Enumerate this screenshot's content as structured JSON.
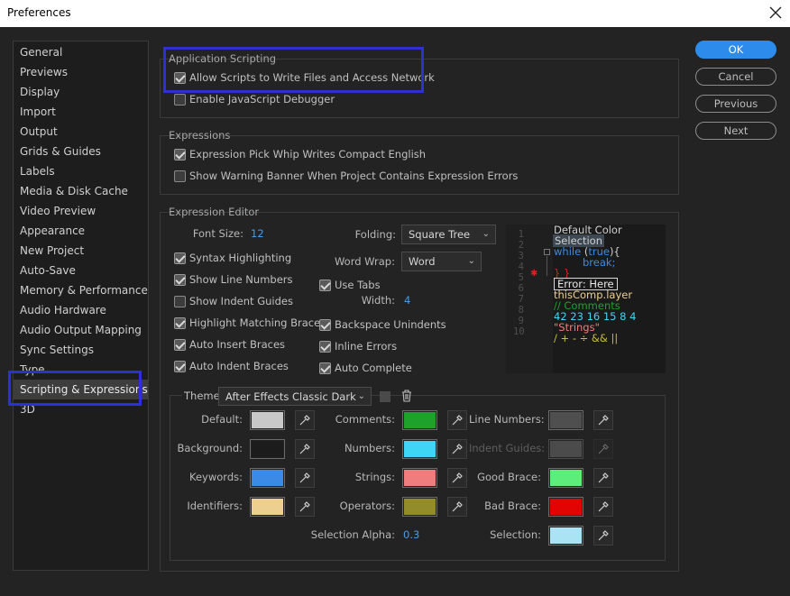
{
  "window": {
    "title": "Preferences"
  },
  "sidebar": {
    "items": [
      {
        "label": "General"
      },
      {
        "label": "Previews"
      },
      {
        "label": "Display"
      },
      {
        "label": "Import"
      },
      {
        "label": "Output"
      },
      {
        "label": "Grids & Guides"
      },
      {
        "label": "Labels"
      },
      {
        "label": "Media & Disk Cache"
      },
      {
        "label": "Video Preview"
      },
      {
        "label": "Appearance"
      },
      {
        "label": "New Project"
      },
      {
        "label": "Auto-Save"
      },
      {
        "label": "Memory & Performance"
      },
      {
        "label": "Audio Hardware"
      },
      {
        "label": "Audio Output Mapping"
      },
      {
        "label": "Sync Settings"
      },
      {
        "label": "Type"
      },
      {
        "label": "Scripting & Expressions"
      },
      {
        "label": "3D"
      }
    ],
    "selected": "Scripting & Expressions"
  },
  "buttons": {
    "ok": "OK",
    "cancel": "Cancel",
    "previous": "Previous",
    "next": "Next"
  },
  "app_scripting": {
    "title": "Application Scripting",
    "allow_scripts": {
      "label": "Allow Scripts to Write Files and Access Network",
      "checked": true
    },
    "js_debugger": {
      "label": "Enable JavaScript Debugger",
      "checked": false
    }
  },
  "expressions": {
    "title": "Expressions",
    "pick_whip": {
      "label": "Expression Pick Whip Writes Compact English",
      "checked": true
    },
    "warning_banner": {
      "label": "Show Warning Banner When Project Contains Expression Errors",
      "checked": false
    }
  },
  "editor": {
    "title": "Expression Editor",
    "font_size_label": "Font Size:",
    "font_size": "12",
    "folding_label": "Folding:",
    "folding_value": "Square Tree",
    "word_wrap_label": "Word Wrap:",
    "word_wrap_value": "Word",
    "use_tabs": {
      "label": "Use Tabs",
      "checked": true
    },
    "width_label": "Width:",
    "width_value": "4",
    "syntax_highlighting": {
      "label": "Syntax Highlighting",
      "checked": true
    },
    "show_line_numbers": {
      "label": "Show Line Numbers",
      "checked": true
    },
    "show_indent_guides": {
      "label": "Show Indent Guides",
      "checked": false
    },
    "highlight_matching_braces": {
      "label": "Highlight Matching Braces",
      "checked": true
    },
    "auto_insert_braces": {
      "label": "Auto Insert Braces",
      "checked": true
    },
    "auto_indent_braces": {
      "label": "Auto Indent Braces",
      "checked": true
    },
    "backspace_unindents": {
      "label": "Backspace Unindents",
      "checked": true
    },
    "inline_errors": {
      "label": "Inline Errors",
      "checked": true
    },
    "auto_complete": {
      "label": "Auto Complete",
      "checked": true
    }
  },
  "preview": {
    "line_numbers": [
      "1",
      "2",
      "3",
      "4",
      "5",
      "6",
      "7",
      "8",
      "9",
      "10"
    ],
    "lines": {
      "default_color": "Default Color",
      "selection": "Selection",
      "while_kw": "while",
      "while_open": " (",
      "while_true": "true",
      "while_close": "){",
      "brk": "break;",
      "closing": "} }",
      "error": "Error: Here",
      "thiscomp": "thisComp.layer",
      "comment": "// Comments",
      "numbers": "42 23 16 15 8 4",
      "strings": "\"Strings\"",
      "operators": "/ + - ÷ && ||"
    }
  },
  "theme": {
    "label": "Theme:",
    "value": "After Effects Classic Dark",
    "colors": {
      "default": {
        "label": "Default:",
        "color": "#c8c8c8"
      },
      "background": {
        "label": "Background:",
        "color": "#1c1c1c"
      },
      "keywords": {
        "label": "Keywords:",
        "color": "#3b8ae6"
      },
      "identifiers": {
        "label": "Identifiers:",
        "color": "#edcf8f"
      },
      "comments": {
        "label": "Comments:",
        "color": "#1ea22c"
      },
      "numbers": {
        "label": "Numbers:",
        "color": "#3ed6f5"
      },
      "strings": {
        "label": "Strings:",
        "color": "#f07d7d"
      },
      "operators": {
        "label": "Operators:",
        "color": "#938c2b"
      },
      "line_numbers": {
        "label": "Line Numbers:",
        "color": "#4f4f4f"
      },
      "indent_guides": {
        "label": "Indent Guides:",
        "color": "#4b4b4b"
      },
      "good_brace": {
        "label": "Good Brace:",
        "color": "#5ded7a"
      },
      "bad_brace": {
        "label": "Bad Brace:",
        "color": "#e20303"
      },
      "selection": {
        "label": "Selection:",
        "color": "#aae3f4"
      }
    },
    "selection_alpha_label": "Selection Alpha:",
    "selection_alpha": "0.3"
  },
  "accent_color": "#2d8ceb",
  "annotation_color": "#2f2fd8"
}
